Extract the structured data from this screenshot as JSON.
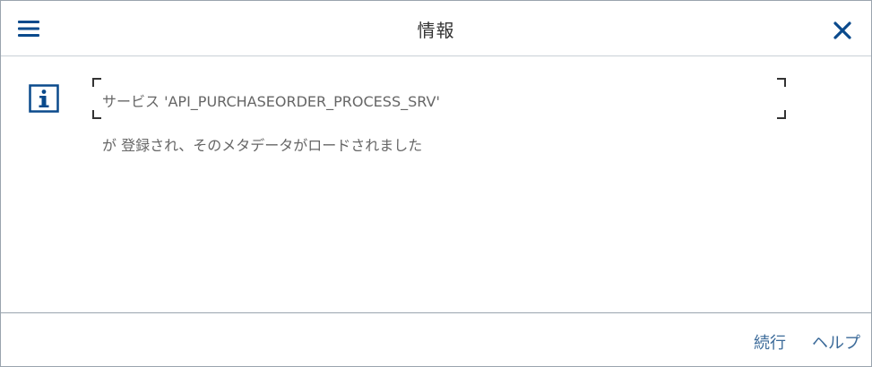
{
  "header": {
    "title": "情報",
    "menu_icon": "hamburger-menu-icon",
    "close_icon": "close-icon"
  },
  "message": {
    "icon": "info-icon",
    "line1": "サービス 'API_PURCHASEORDER_PROCESS_SRV'",
    "line2": "が 登録され、そのメタデータがロードされました"
  },
  "footer": {
    "continue_label": "続行",
    "help_label": "ヘルプ"
  },
  "colors": {
    "accent": "#0a4a8c",
    "link": "#3b6a99",
    "text": "#666666",
    "border": "#9aa4ae"
  }
}
